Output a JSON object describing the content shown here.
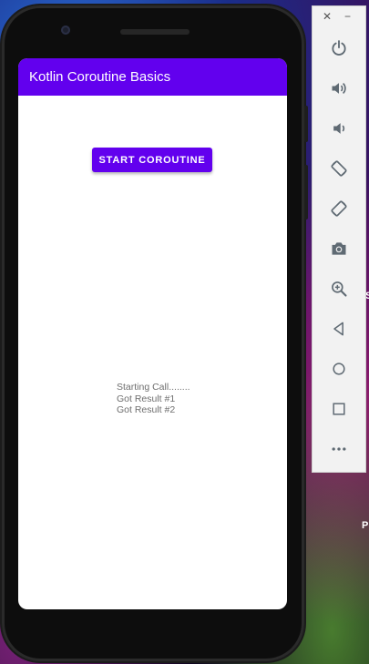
{
  "app": {
    "title": "Kotlin Coroutine Basics",
    "start_button_label": "START COROUTINE",
    "log_lines": [
      "Starting Call........",
      "Got Result #1",
      "Got Result #2"
    ]
  },
  "emulator_toolbar": {
    "close_label": "✕",
    "minimize_label": "−",
    "tools": [
      {
        "name": "power-icon"
      },
      {
        "name": "volume-up-icon"
      },
      {
        "name": "volume-down-icon"
      },
      {
        "name": "rotate-left-icon"
      },
      {
        "name": "rotate-right-icon"
      },
      {
        "name": "camera-icon"
      },
      {
        "name": "zoom-icon"
      },
      {
        "name": "back-icon"
      },
      {
        "name": "home-icon"
      },
      {
        "name": "overview-icon"
      },
      {
        "name": "more-icon"
      }
    ]
  },
  "desktop": {
    "edge_text_1": "S",
    "edge_text_2": "P"
  },
  "colors": {
    "primary": "#6200ee",
    "toolbar_icon": "#5f6a73"
  }
}
